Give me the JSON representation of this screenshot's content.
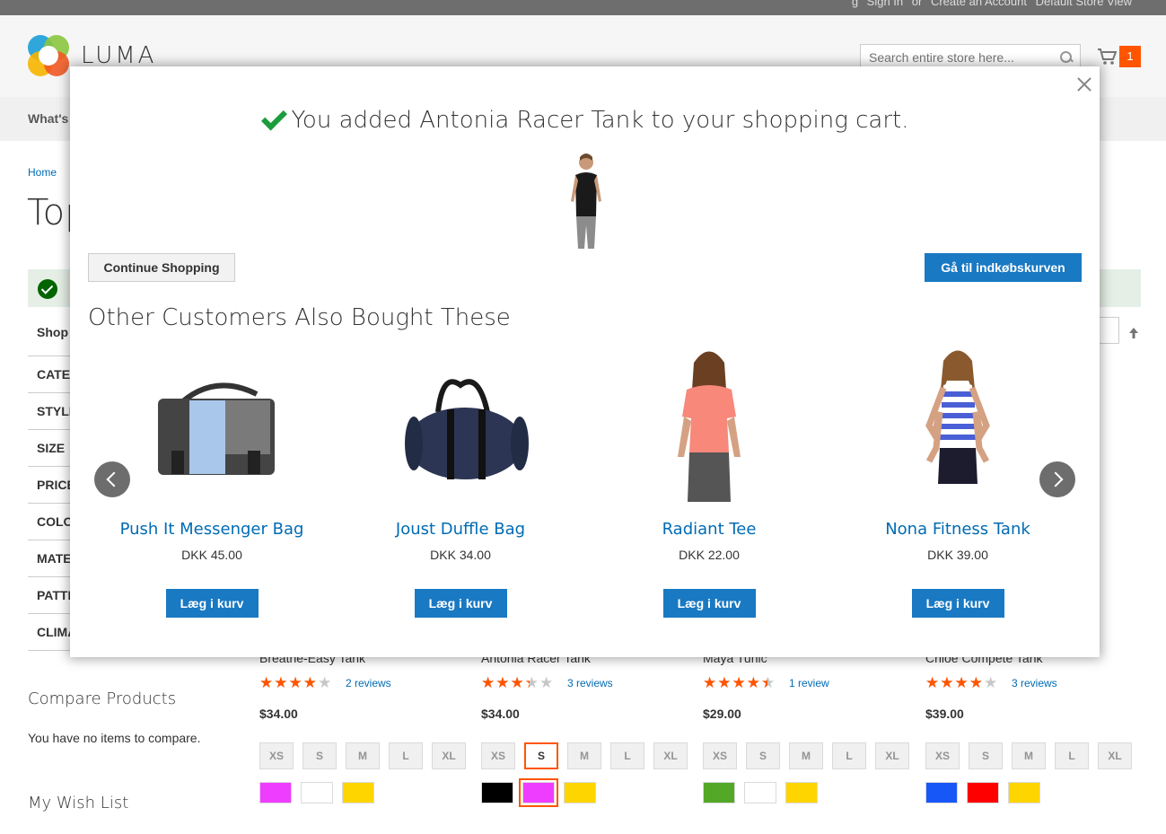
{
  "topbar": {
    "links": [
      "g",
      "Sign In",
      "or",
      "Create an Account",
      "Default Store View"
    ]
  },
  "header": {
    "logo_text": "LUMA",
    "search_placeholder": "Search entire store here...",
    "cart_count": "1"
  },
  "nav": {
    "first_item": "What's"
  },
  "breadcrumb": "Home",
  "page_title": "Top",
  "sidebar": {
    "shop_by": "Shop",
    "filters": [
      "CATEG",
      "STYLE",
      "SIZE",
      "PRICE",
      "COLO",
      "MATE",
      "PATTE",
      "CLIMA"
    ],
    "compare_title": "Compare Products",
    "compare_empty": "You have no items to compare.",
    "wishlist_title": "My Wish List"
  },
  "products": [
    {
      "name": "Breathe-Easy Tank",
      "rating_percent": 70,
      "reviews": "2 reviews",
      "price": "$34.00",
      "sizes": [
        "XS",
        "S",
        "M",
        "L",
        "XL"
      ],
      "selected_size": "",
      "swatches": [
        "#ef3dff",
        "#ffffff",
        "#ffd500"
      ],
      "selected_swatch": -1
    },
    {
      "name": "Antonia Racer Tank",
      "rating_percent": 60,
      "reviews": "3 reviews",
      "price": "$34.00",
      "sizes": [
        "XS",
        "S",
        "M",
        "L",
        "XL"
      ],
      "selected_size": "S",
      "swatches": [
        "#000000",
        "#ef3dff",
        "#ffd500"
      ],
      "selected_swatch": 1
    },
    {
      "name": "Maya Tunic",
      "rating_percent": 80,
      "reviews": "1 review",
      "price": "$29.00",
      "sizes": [
        "XS",
        "S",
        "M",
        "L",
        "XL"
      ],
      "selected_size": "",
      "swatches": [
        "#53a828",
        "#ffffff",
        "#ffd500"
      ],
      "selected_swatch": -1
    },
    {
      "name": "Chloe Compete Tank",
      "rating_percent": 70,
      "reviews": "3 reviews",
      "price": "$39.00",
      "sizes": [
        "XS",
        "S",
        "M",
        "L",
        "XL"
      ],
      "selected_size": "",
      "swatches": [
        "#1857f7",
        "#ff0000",
        "#ffd500"
      ],
      "selected_swatch": -1
    }
  ],
  "modal": {
    "message": "You added Antonia Racer Tank to your shopping cart.",
    "continue_label": "Continue Shopping",
    "go_to_cart_label": "Gå til indkøbskurven",
    "others_title": "Other Customers Also Bought These",
    "recommendations": [
      {
        "name": "Push It Messenger Bag",
        "price": "DKK 45.00",
        "button": "Læg i kurv",
        "image": "messenger-bag"
      },
      {
        "name": "Joust Duffle Bag",
        "price": "DKK 34.00",
        "button": "Læg i kurv",
        "image": "duffle-bag"
      },
      {
        "name": "Radiant Tee",
        "price": "DKK 22.00",
        "button": "Læg i kurv",
        "image": "woman-tee"
      },
      {
        "name": "Nona Fitness Tank",
        "price": "DKK 39.00",
        "button": "Læg i kurv",
        "image": "woman-tank"
      }
    ]
  },
  "colors": {
    "accent_blue": "#1979c3",
    "link_blue": "#006bb4",
    "orange": "#ff5501",
    "check_green": "#1c9c3c"
  }
}
